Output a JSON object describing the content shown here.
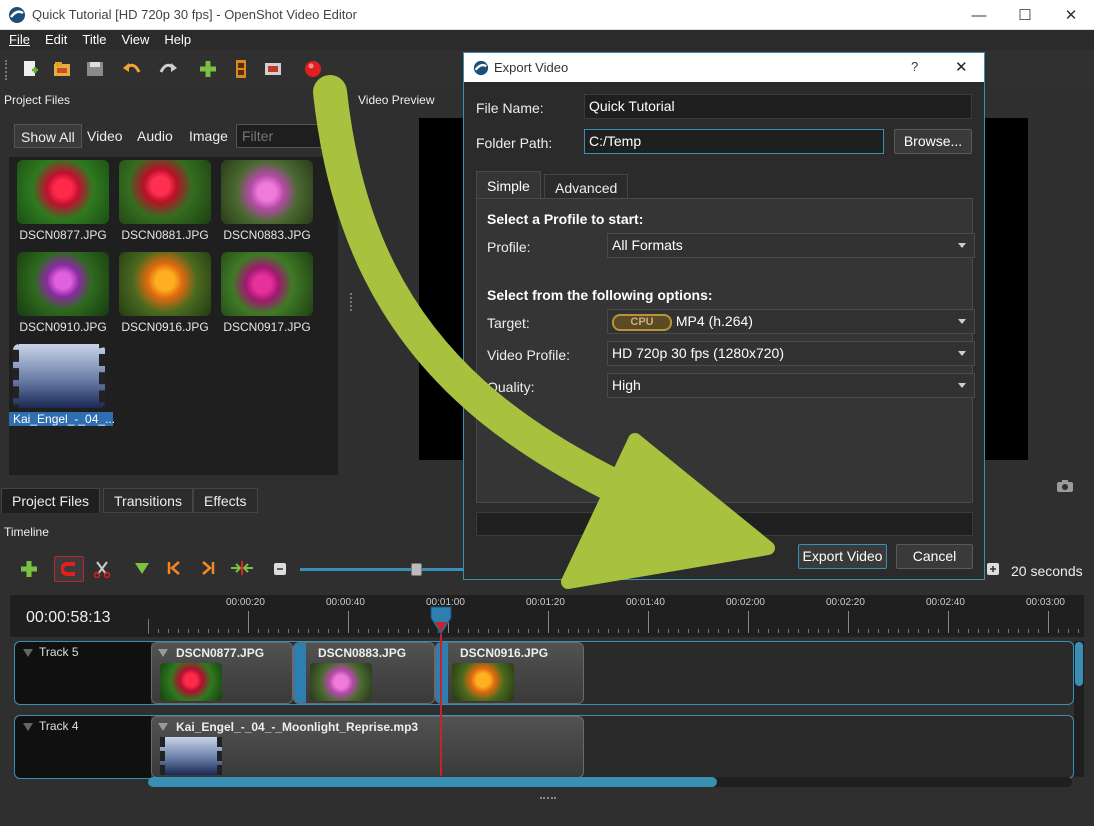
{
  "window": {
    "title": "Quick Tutorial [HD 720p 30 fps] - OpenShot Video Editor",
    "controls": [
      "minimize-icon",
      "maximize-icon",
      "close-icon"
    ]
  },
  "menu": [
    "File",
    "Edit",
    "Title",
    "View",
    "Help"
  ],
  "toolbar": {
    "icons": [
      "new-project-icon",
      "open-project-icon",
      "save-project-icon",
      "undo-icon",
      "redo-icon",
      "import-files-icon",
      "choose-profile-icon",
      "fullscreen-icon",
      "export-video-icon"
    ]
  },
  "project_files": {
    "header": "Project Files",
    "filters": [
      "Show All",
      "Video",
      "Audio",
      "Image"
    ],
    "filter_placeholder": "Filter",
    "items": [
      {
        "name": "DSCN0877.JPG",
        "kind": "image"
      },
      {
        "name": "DSCN0881.JPG",
        "kind": "image"
      },
      {
        "name": "DSCN0883.JPG",
        "kind": "image"
      },
      {
        "name": "DSCN0910.JPG",
        "kind": "image"
      },
      {
        "name": "DSCN0916.JPG",
        "kind": "image"
      },
      {
        "name": "DSCN0917.JPG",
        "kind": "image"
      },
      {
        "name": "Kai_Engel_-_04_...",
        "kind": "audio",
        "selected": true
      }
    ]
  },
  "bottom_tabs": [
    "Project Files",
    "Transitions",
    "Effects"
  ],
  "preview": {
    "header": "Video Preview"
  },
  "timeline": {
    "header": "Timeline",
    "current_time": "00:00:58:13",
    "zoom_label": "20 seconds",
    "ruler_ticks": [
      "00:00:20",
      "00:00:40",
      "00:01:00",
      "00:01:20",
      "00:01:40",
      "00:02:00",
      "00:02:20",
      "00:02:40",
      "00:03:00"
    ],
    "tracks": [
      {
        "name": "Track 5",
        "clips": [
          "DSCN0877.JPG",
          "DSCN0883.JPG",
          "DSCN0916.JPG"
        ]
      },
      {
        "name": "Track 4",
        "clips": [
          "Kai_Engel_-_04_-_Moonlight_Reprise.mp3"
        ]
      }
    ]
  },
  "export_dialog": {
    "title": "Export Video",
    "help": "?",
    "close": "✕",
    "file_name_label": "File Name:",
    "file_name_value": "Quick Tutorial",
    "folder_path_label": "Folder Path:",
    "folder_path_value": "C:/Temp",
    "browse_label": "Browse...",
    "tabs": [
      "Simple",
      "Advanced"
    ],
    "select_profile_heading": "Select a Profile to start:",
    "profile_label": "Profile:",
    "profile_value": "All Formats",
    "options_heading": "Select from the following options:",
    "target_label": "Target:",
    "target_badge": "CPU",
    "target_value": "MP4 (h.264)",
    "video_profile_label": "Video Profile:",
    "video_profile_value": "HD 720p 30 fps (1280x720)",
    "quality_label": "Quality:",
    "quality_value": "High",
    "export_button": "Export Video",
    "cancel_button": "Cancel"
  },
  "colors": {
    "accent": "#3a8fb5",
    "arrow": "#a8c13e",
    "playhead": "#c0262e",
    "record": "#e02020"
  }
}
